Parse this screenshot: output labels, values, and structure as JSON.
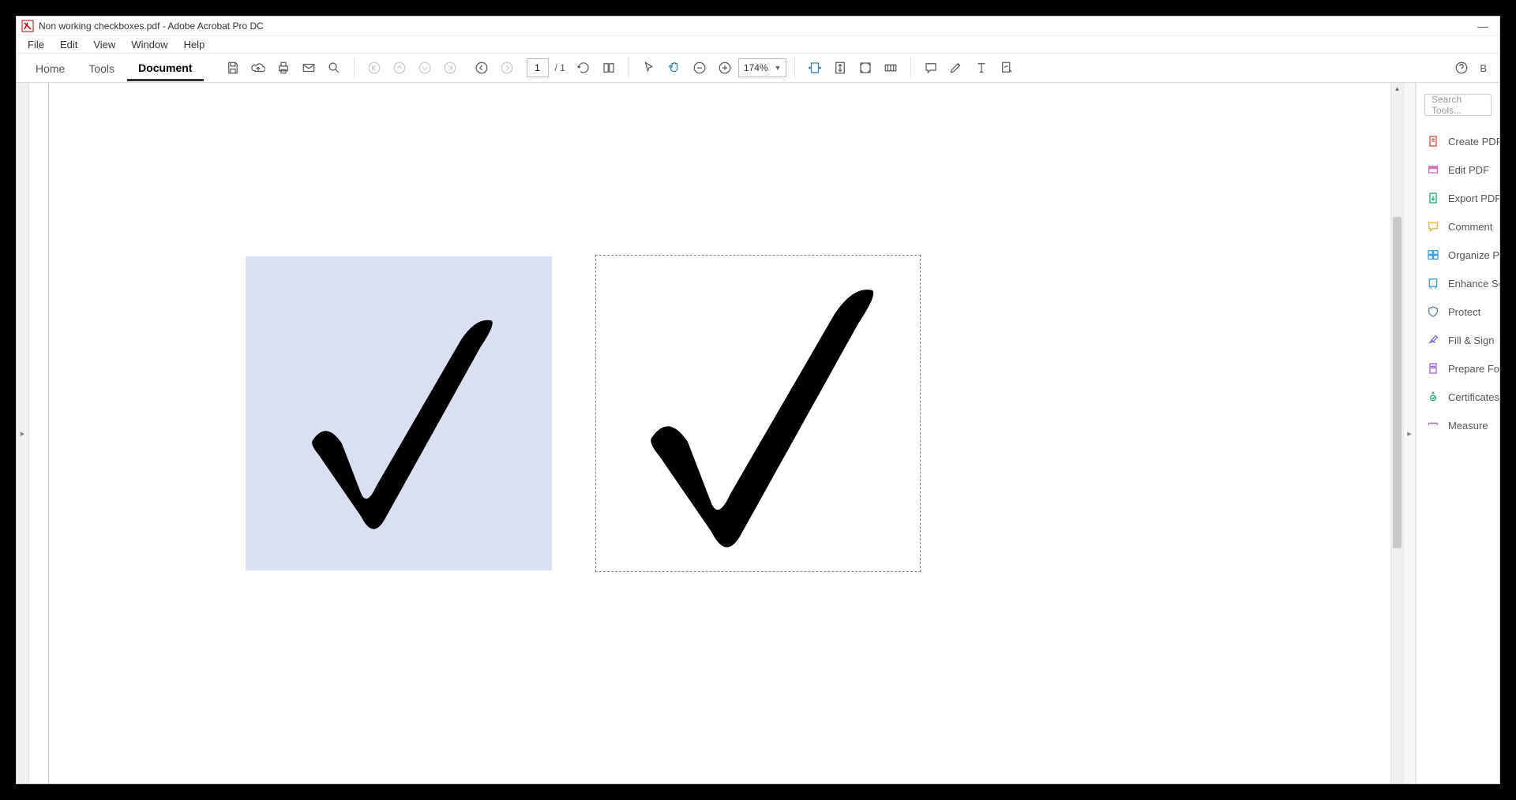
{
  "window": {
    "title": "Non working checkboxes.pdf - Adobe Acrobat Pro DC"
  },
  "menubar": {
    "file": "File",
    "edit": "Edit",
    "view": "View",
    "window": "Window",
    "help": "Help"
  },
  "tabs": {
    "home": "Home",
    "tools": "Tools",
    "document": "Document"
  },
  "toolbar": {
    "page_current": "1",
    "page_total": "/ 1",
    "zoom": "174%",
    "share_trunc": "B"
  },
  "right_panel": {
    "search_placeholder": "Search Tools...",
    "items": [
      {
        "label": "Create PDF",
        "color": "#d94b3f"
      },
      {
        "label": "Edit PDF",
        "color": "#d96fbf"
      },
      {
        "label": "Export PDF",
        "color": "#2aa372"
      },
      {
        "label": "Comment",
        "color": "#e6b633"
      },
      {
        "label": "Organize Pa",
        "color": "#3a9fd8"
      },
      {
        "label": "Enhance Sc",
        "color": "#3a9fd8"
      },
      {
        "label": "Protect",
        "color": "#5c7ea3"
      },
      {
        "label": "Fill & Sign",
        "color": "#7b6fd1"
      },
      {
        "label": "Prepare For",
        "color": "#9b64c9"
      },
      {
        "label": "Certificates",
        "color": "#2aa372"
      },
      {
        "label": "Measure",
        "color": "#c46fc4"
      }
    ]
  }
}
